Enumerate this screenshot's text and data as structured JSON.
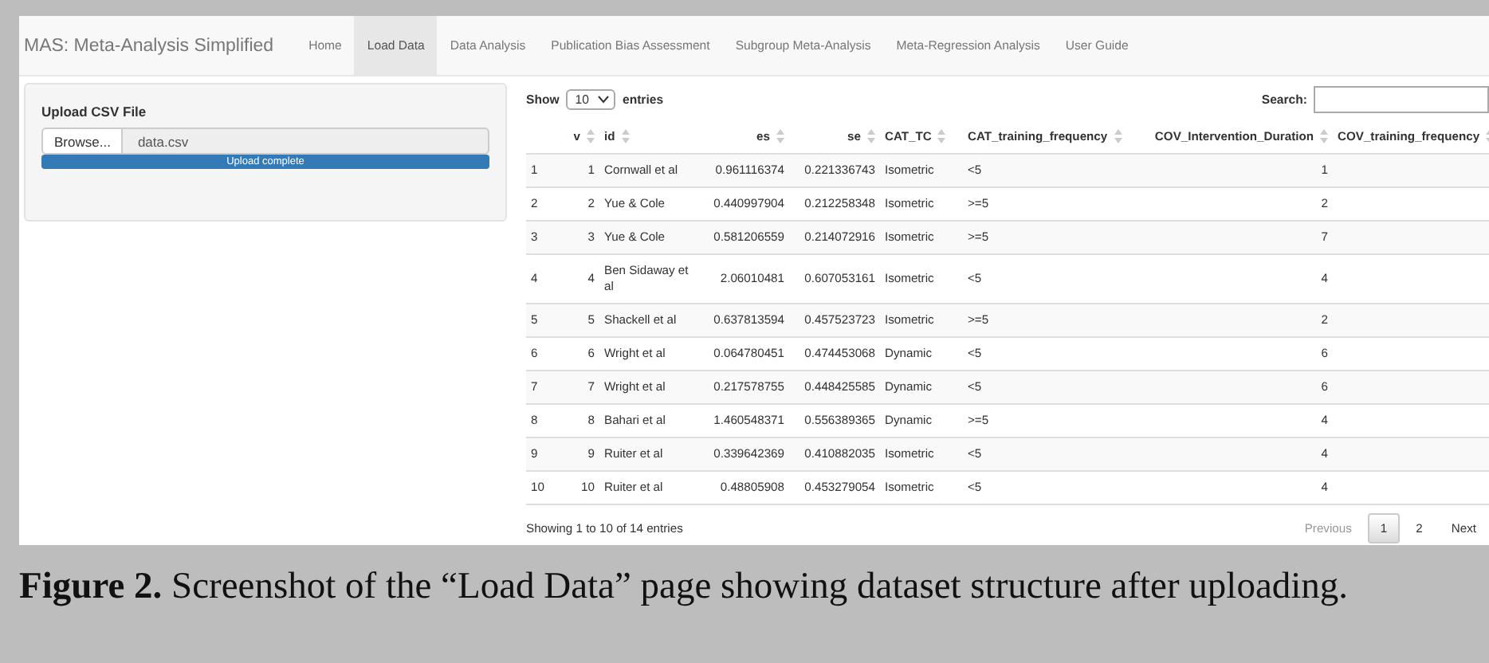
{
  "navbar": {
    "brand": "MAS: Meta-Analysis Simplified",
    "tabs": [
      {
        "label": "Home",
        "selected": false
      },
      {
        "label": "Load Data",
        "selected": true
      },
      {
        "label": "Data Analysis",
        "selected": false
      },
      {
        "label": "Publication Bias Assessment",
        "selected": false
      },
      {
        "label": "Subgroup Meta-Analysis",
        "selected": false
      },
      {
        "label": "Meta-Regression Analysis",
        "selected": false
      },
      {
        "label": "User Guide",
        "selected": false
      }
    ]
  },
  "sidebar": {
    "title": "Upload CSV File",
    "browse_button": "Browse...",
    "file_name": "data.csv",
    "progress": {
      "label": "Upload complete",
      "level": 1
    }
  },
  "table": {
    "show_label": "Show",
    "page_length": "10",
    "entries_label": "entries",
    "search_label": "Search:",
    "columns": [
      {
        "label": "v",
        "kind": "number"
      },
      {
        "label": "id",
        "kind": "text"
      },
      {
        "label": "es",
        "kind": "number"
      },
      {
        "label": "se",
        "kind": "number"
      },
      {
        "label": "CAT_TC",
        "kind": "text"
      },
      {
        "label": "CAT_training_frequency",
        "kind": "text"
      },
      {
        "label": "COV_Intervention_Duration",
        "kind": "number"
      },
      {
        "label": "COV_training_frequency",
        "kind": "number"
      }
    ],
    "rows": [
      {
        "index": "1",
        "cells": [
          "1",
          "Cornwall et al",
          "0.961116374",
          "0.221336743",
          "Isometric",
          "<5",
          "1"
        ]
      },
      {
        "index": "2",
        "cells": [
          "2",
          "Yue & Cole",
          "0.440997904",
          "0.212258348",
          "Isometric",
          ">=5",
          "2"
        ]
      },
      {
        "index": "3",
        "cells": [
          "3",
          "Yue & Cole",
          "0.581206559",
          "0.214072916",
          "Isometric",
          ">=5",
          "7"
        ]
      },
      {
        "index": "4",
        "cells": [
          "4",
          "Ben Sidaway et al",
          "2.06010481",
          "0.607053161",
          "Isometric",
          "<5",
          "4"
        ]
      },
      {
        "index": "5",
        "cells": [
          "5",
          "Shackell et al",
          "0.637813594",
          "0.457523723",
          "Isometric",
          ">=5",
          "2"
        ]
      },
      {
        "index": "6",
        "cells": [
          "6",
          "Wright et al",
          "0.064780451",
          "0.474453068",
          "Dynamic",
          "<5",
          "6"
        ]
      },
      {
        "index": "7",
        "cells": [
          "7",
          "Wright et al",
          "0.217578755",
          "0.448425585",
          "Dynamic",
          "<5",
          "6"
        ]
      },
      {
        "index": "8",
        "cells": [
          "8",
          "Bahari et al",
          "1.460548371",
          "0.556389365",
          "Dynamic",
          ">=5",
          "4"
        ]
      },
      {
        "index": "9",
        "cells": [
          "9",
          "Ruiter et al",
          "0.339642369",
          "0.410882035",
          "Isometric",
          "<5",
          "4"
        ]
      },
      {
        "index": "10",
        "cells": [
          "10",
          "Ruiter et al",
          "0.48805908",
          "0.453279054",
          "Isometric",
          "<5",
          "4"
        ]
      }
    ],
    "info": "Showing 1 to 10 of 14 entries",
    "pagination": {
      "previous": {
        "label": "Previous",
        "disabled": true
      },
      "pages": [
        {
          "label": "1",
          "selected": true
        },
        {
          "label": "2",
          "selected": false
        }
      ],
      "next": {
        "label": "Next",
        "disabled": false
      }
    }
  },
  "caption": "**Figure 2.** Screenshot of the “Load Data” page showing dataset structure after uploading."
}
